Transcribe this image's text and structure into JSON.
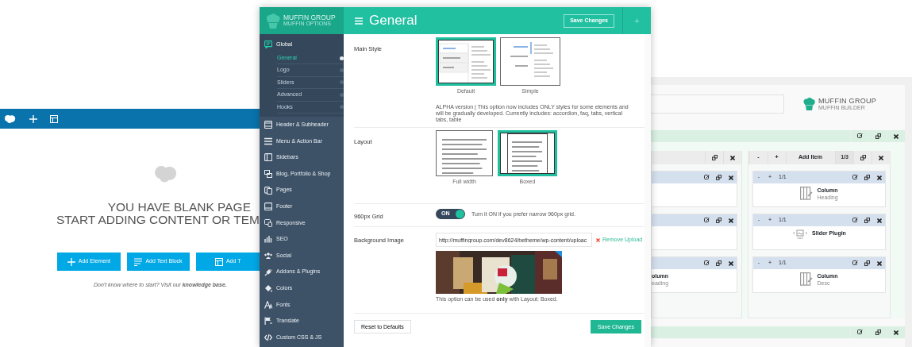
{
  "blank_page": {
    "heading": [
      "YOU HAVE BLANK PAGE",
      "START ADDING CONTENT OR TEM"
    ],
    "buttons": [
      {
        "label": "Add Element",
        "kind": "element"
      },
      {
        "label": "Add Text Block",
        "kind": "text"
      },
      {
        "label": "Add T",
        "kind": "template"
      }
    ],
    "hint": "Don't know where to start? Visit our **knowledge base.**"
  },
  "options": {
    "brand": "MUFFIN GROUP",
    "subbrand": "MUFFIN OPTIONS",
    "page_title": "General",
    "save_label": "Save Changes",
    "add_label": "+",
    "menu": [
      {
        "label": "Global",
        "expanded": true,
        "children": [
          {
            "label": "General",
            "selected": true
          },
          {
            "label": "Logo",
            "selected": false
          },
          {
            "label": "Sliders",
            "selected": false
          },
          {
            "label": "Advanced",
            "selected": false
          },
          {
            "label": "Hooks",
            "selected": false
          }
        ]
      },
      {
        "label": "Header & Subheader",
        "expanded": false
      },
      {
        "label": "Menu & Action Bar",
        "expanded": false
      },
      {
        "label": "Sidebars",
        "expanded": false
      },
      {
        "label": "Blog, Portfolio & Shop",
        "expanded": false
      },
      {
        "label": "Pages",
        "expanded": false
      },
      {
        "label": "Footer",
        "expanded": false
      },
      {
        "label": "Responsive",
        "expanded": false
      },
      {
        "label": "SEO",
        "expanded": false
      },
      {
        "label": "Social",
        "expanded": false
      },
      {
        "label": "Addons & Plugins",
        "expanded": false
      },
      {
        "label": "Colors",
        "expanded": false
      },
      {
        "label": "Fonts",
        "expanded": false
      },
      {
        "label": "Translate",
        "expanded": false
      },
      {
        "label": "Custom CSS & JS",
        "expanded": false
      }
    ],
    "fields": [
      {
        "kind": "style",
        "label": "Main Style",
        "options": [
          {
            "caption": "Default",
            "selected": true
          },
          {
            "caption": "Simple",
            "selected": false
          }
        ],
        "note": "ALPHA version | This option now includes ONLY styles for some elements and will be gradually developed. Currently includes: accordion, faq, tabs, vertical tabs, table"
      },
      {
        "kind": "layout",
        "label": "Layout",
        "options": [
          {
            "caption": "Full width",
            "selected": false
          },
          {
            "caption": "Boxed",
            "selected": true
          }
        ]
      },
      {
        "kind": "toggle",
        "label": "960px Grid",
        "on": true,
        "state_text": "ON",
        "hint": "Turn it ON if you prefer narrow 960px grid."
      },
      {
        "kind": "upload",
        "label": "Background Image",
        "value": "http://muffingroup.com/dev8624/betheme/wp-content/uploac",
        "remove_label": "Remove Upload",
        "note": "This option can be used **only** with Layout: Boxed."
      }
    ],
    "reset_label": "Reset to Defaults",
    "footer_save_label": "Save Changes"
  },
  "builder": {
    "brand": "MUFFIN GROUP",
    "subbrand": "MUFFIN BUILDER",
    "wraps": [
      {
        "items": [
          {
            "kind": "none"
          },
          {
            "kind": "none"
          },
          {
            "title": "olumn",
            "subtitle": "eading",
            "kind": "none"
          }
        ]
      },
      {
        "controls": [
          "-",
          "+",
          "Add Item"
        ],
        "size": "1/3",
        "items": [
          {
            "size": "1/1",
            "title": "Column",
            "subtitle": "Heading",
            "kind": "column"
          },
          {
            "size": "1/1",
            "title": "Slider Plugin",
            "kind": "slider"
          },
          {
            "size": "1/1",
            "title": "Column",
            "subtitle": "Desc",
            "kind": "column"
          }
        ]
      }
    ],
    "item_controls": [
      "-",
      "+"
    ]
  }
}
